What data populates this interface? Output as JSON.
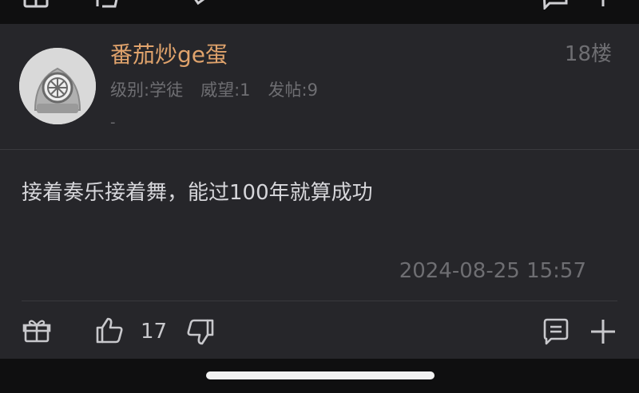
{
  "post": {
    "username": "番茄炒ge蛋",
    "floor": "18楼",
    "level": "级别:学徒",
    "prestige": "威望:1",
    "posts": "发帖:9",
    "signature": "-",
    "content": "接着奏乐接着舞，能过100年就算成功",
    "timestamp": "2024-08-25 15:57",
    "like_count": "17"
  },
  "bottom": {
    "next_title_partial": "……"
  },
  "colors": {
    "username": "#e0a36c",
    "background": "#26262a",
    "muted": "#6e6e72"
  }
}
